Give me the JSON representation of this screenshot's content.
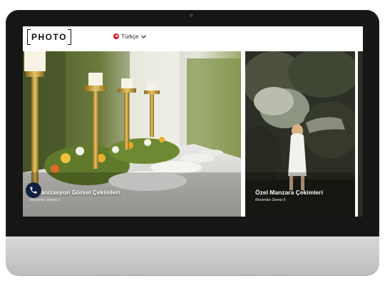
{
  "site": {
    "logo_text": "PHOTO",
    "language": {
      "label": "Türkçe",
      "flag_icon": "turkey-flag-icon",
      "chevron_icon": "chevron-down-icon"
    }
  },
  "slides": [
    {
      "title": "Organizasyon Görsel Çekimleri",
      "subtitle": "Resimler Demo 1"
    },
    {
      "title": "Özel Manzara Çekimleri",
      "subtitle": "Resimler Demo 5"
    }
  ],
  "contact": {
    "icon": "phone-icon"
  },
  "colors": {
    "fab": "#0f2040",
    "flag": "#d4202a",
    "bezel": "#161616",
    "chin": "#cccccc"
  }
}
